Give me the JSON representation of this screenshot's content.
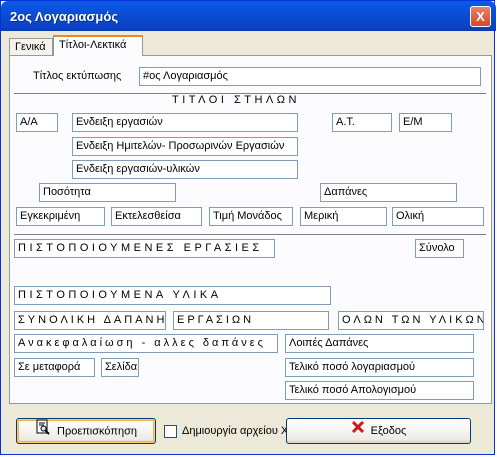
{
  "window": {
    "title": "2ος Λογαριασμός",
    "close_glyph": "X"
  },
  "tabs": [
    "Γενικά",
    "Τίτλοι-Λεκτικά"
  ],
  "print_title": {
    "label": "Τίτλος εκτύπωσης",
    "value": "#ος Λογαριασμός"
  },
  "column_titles_header": "ΤΙΤΛΟΙ ΣΤΗΛΩΝ",
  "fields": {
    "aa": "Α/Α",
    "work_indication": "Ενδειξη εργασιών",
    "semi_temp_indication": "Ενδειξη Ημιτελών- Προσωρινών Εργασιών",
    "work_materials_indication": "Ενδειξη εργασιών-υλικών",
    "at": "Α.Τ.",
    "em": "Ε/Μ",
    "quantity": "Ποσότητα",
    "expenses": "Δαπάνες",
    "approved": "Εγκεκριμένη",
    "executed": "Εκτελεσθείσα",
    "unit_price": "Τιμή Μονάδος",
    "partial": "Μερική",
    "total": "Ολική",
    "certified_works": "ΠΙΣΤΟΠΟΙΟΥΜΕΝΕΣ ΕΡΓΑΣΙΕΣ",
    "sum": "Σύνολο",
    "certified_materials": "ΠΙΣΤΟΠΟΙΟΥΜΕΝΑ ΥΛΙΚΑ",
    "total_cost": "ΣΥΝΟΛΙΚΗ ΔΑΠΑΝΗ",
    "works": "ΕΡΓΑΣΙΩΝ",
    "all_materials": "ΟΛΩΝ ΤΩΝ ΥΛΙΚΩΝ",
    "recap": "Ανακεφαλαίωση - αλλες δαπάνες",
    "other_expenses": "Λοιπές Δαπάνες",
    "carry_over": "Σε μεταφορά",
    "page": "Σελίδα",
    "final_account": "Τελικό ποσό λογαριασμού",
    "final_report": "Τελικό ποσό Απολογισμού"
  },
  "footer": {
    "preview_button": "Προεπισκόπηση",
    "xls_checkbox_label": "Δημιουργία αρχείου XLS",
    "xls_checked": false,
    "exit_button": "Εξοδος"
  },
  "icons": {
    "preview": "print-preview-icon",
    "exit": "red-x-icon",
    "close": "close-icon"
  },
  "colors": {
    "titlebar": "#0a5ae8",
    "tab_accent": "#e68b2c",
    "exit_icon": "#c81a1a"
  }
}
